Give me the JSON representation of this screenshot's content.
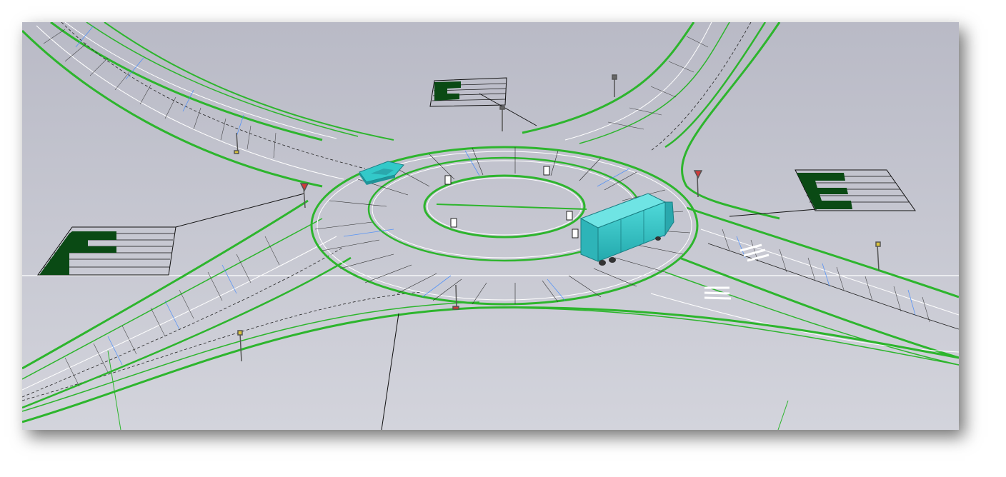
{
  "viewport": {
    "background_top": "#b9bac6",
    "background_bottom": "#d2d3dc",
    "colors": {
      "road_edge": "#2db52d",
      "lane_line": "#ffffff",
      "mesh": "#2a2a2a",
      "cross_section": "#3a86ff",
      "vehicle": "#33c9c9",
      "signal_block": "#0a4a14",
      "horizon": "#ffffff"
    },
    "objects": [
      {
        "kind": "roundabout",
        "icon": "roundabout-icon"
      },
      {
        "kind": "vehicle",
        "type": "car",
        "icon": "car-icon"
      },
      {
        "kind": "vehicle",
        "type": "truck",
        "icon": "truck-icon"
      },
      {
        "kind": "signal-plan",
        "count": 3,
        "icon": "signal-timing-icon"
      },
      {
        "kind": "sign-post",
        "icon": "sign-post-icon"
      }
    ]
  }
}
